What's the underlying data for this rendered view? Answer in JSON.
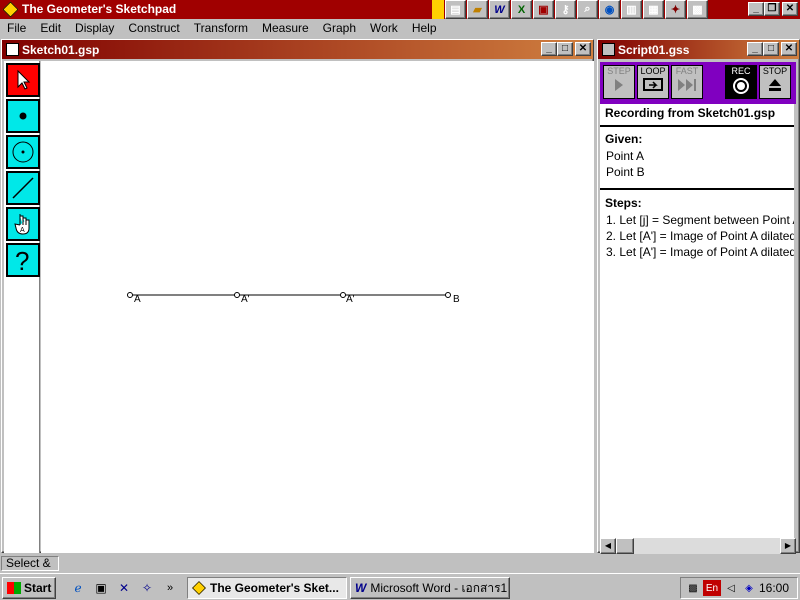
{
  "app": {
    "title": "The Geometer's Sketchpad"
  },
  "menu": [
    {
      "label": "File"
    },
    {
      "label": "Edit"
    },
    {
      "label": "Display"
    },
    {
      "label": "Construct"
    },
    {
      "label": "Transform"
    },
    {
      "label": "Measure"
    },
    {
      "label": "Graph"
    },
    {
      "label": "Work"
    },
    {
      "label": "Help"
    }
  ],
  "sketch": {
    "title": "Sketch01.gsp",
    "points": [
      {
        "label": "A"
      },
      {
        "label": "A'"
      },
      {
        "label": "A'"
      },
      {
        "label": "B"
      }
    ]
  },
  "script": {
    "title": "Script01.gss",
    "controls": {
      "step": "STEP",
      "loop": "LOOP",
      "fast": "FAST",
      "rec": "REC",
      "stop": "STOP"
    },
    "recording": "Recording from Sketch01.gsp",
    "given_title": "Given:",
    "given": [
      "Point A",
      "Point B"
    ],
    "steps_title": "Steps:",
    "steps": [
      "1. Let [j] = Segment between Point A",
      "2. Let [A'] = Image of Point A dilated",
      "3. Let [A'] = Image of Point A dilated"
    ]
  },
  "status": {
    "text": "Select &"
  },
  "taskbar": {
    "start": "Start",
    "tasks": [
      {
        "label": "The Geometer's Sket..."
      },
      {
        "label": "Microsoft Word - เอกสาร1"
      }
    ],
    "tray": {
      "lang": "En",
      "clock": "16:00"
    }
  },
  "colors": {
    "title_active": "#a00000",
    "tool_bg": "#00e8e8",
    "tool_active": "#ff0000",
    "rec_panel": "#8000c0"
  }
}
